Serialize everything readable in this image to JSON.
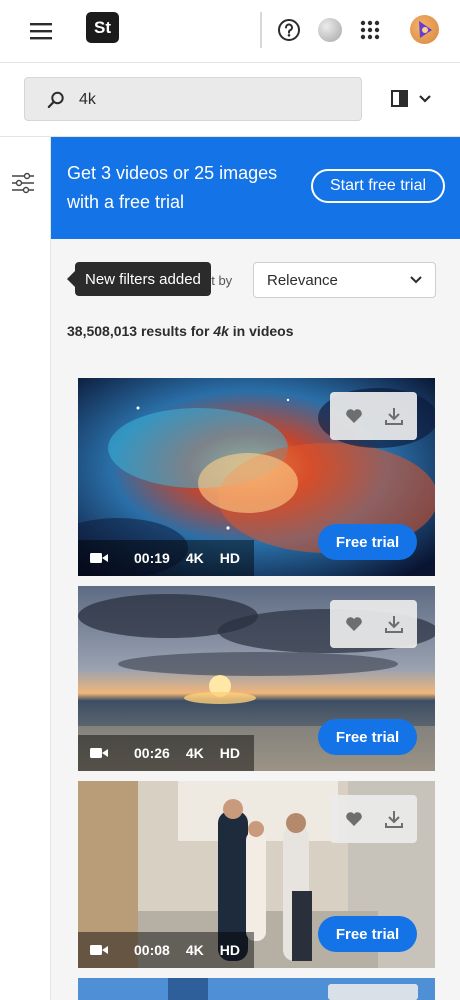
{
  "header": {
    "logo_text": "St",
    "menu_icon": "hamburger-icon",
    "help_icon": "help-circle-icon",
    "apps_icon": "apps-grid-icon"
  },
  "search": {
    "value": "4k",
    "placeholder": "Search"
  },
  "promo": {
    "text": "Get 3 videos or 25 images with a free trial",
    "button_label": "Start free trial",
    "background": "#1473e6"
  },
  "sort": {
    "label": "Sort by",
    "value": "Relevance"
  },
  "tooltip": {
    "text": "New filters added"
  },
  "results": {
    "count": "38,508,013",
    "mid": " results for ",
    "query": "4k",
    "scope_prefix": " in ",
    "scope": "videos"
  },
  "cards": [
    {
      "duration": "00:19",
      "res": "4K",
      "quality": "HD",
      "cta": "Free trial",
      "subject": "nebula"
    },
    {
      "duration": "00:26",
      "res": "4K",
      "quality": "HD",
      "cta": "Free trial",
      "subject": "sunset"
    },
    {
      "duration": "00:08",
      "res": "4K",
      "quality": "HD",
      "cta": "Free trial",
      "subject": "walk"
    }
  ],
  "colors": {
    "accent": "#1473e6",
    "tooltip_bg": "#2b2b2b"
  }
}
